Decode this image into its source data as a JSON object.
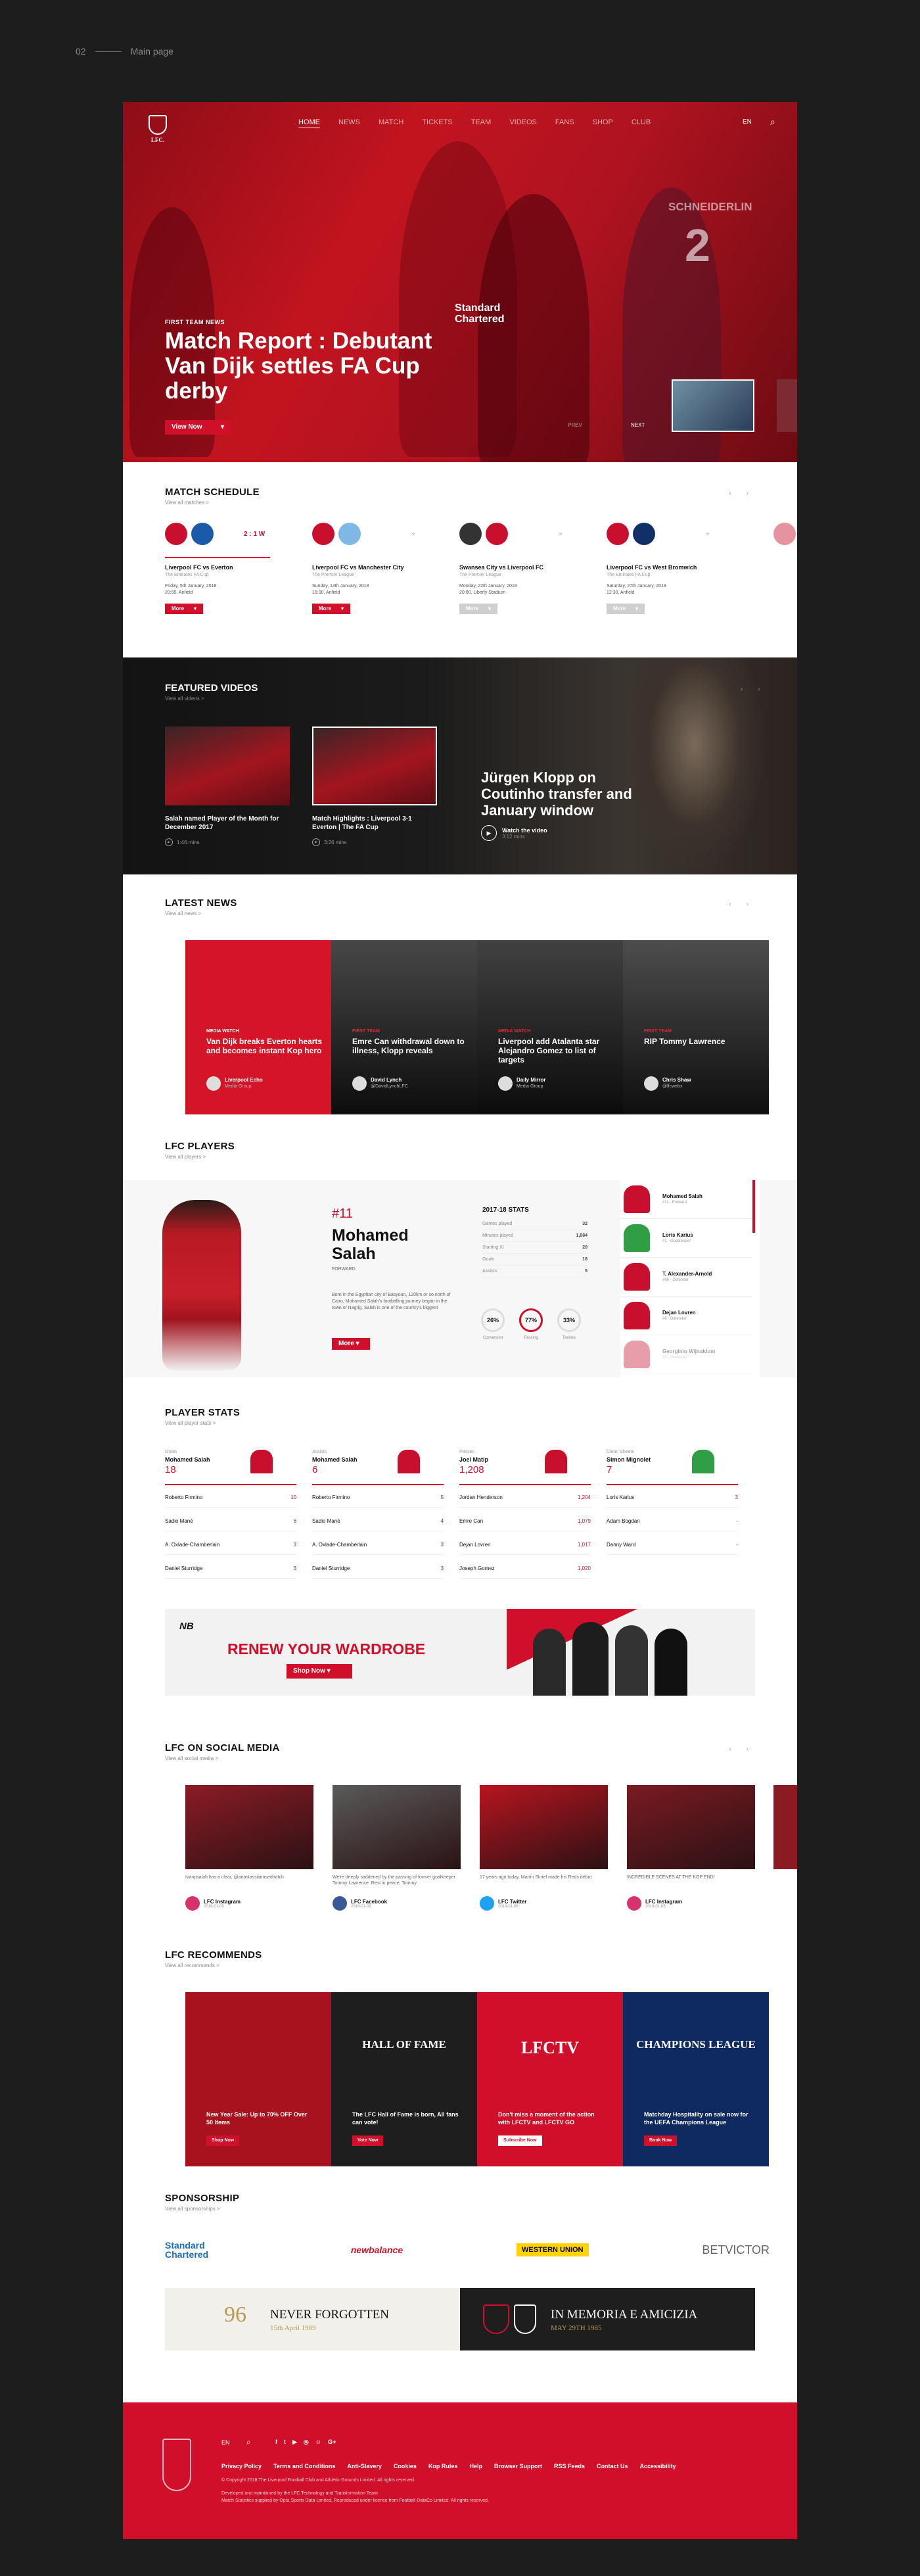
{
  "page_label": {
    "num": "02",
    "text": "Main page"
  },
  "nav": {
    "logo_text": "LFC.",
    "items": [
      "HOME",
      "NEWS",
      "MATCH",
      "TICKETS",
      "TEAM",
      "VIDEOS",
      "FANS",
      "SHOP",
      "CLUB"
    ],
    "lang": "EN"
  },
  "hero": {
    "kicker": "FIRST TEAM NEWS",
    "title": "Match Report : Debutant Van Dijk settles FA Cup derby",
    "button": "View Now",
    "sponsor": "Standard Chartered",
    "shirt_text": "SCHNEIDERLIN",
    "shirt_num": "2",
    "prev": "PREV",
    "next": "NEXT"
  },
  "schedule": {
    "title": "MATCH SCHEDULE",
    "sub": "View all matches >",
    "matches": [
      {
        "teams": "Liverpool FC vs Everton",
        "comp": "The Emirates FA Cup",
        "date": "Friday, 5th January, 2018",
        "venue": "20:55, Anfield",
        "score": "2 : 1 W",
        "btn": "More"
      },
      {
        "teams": "Liverpool FC vs Manchester City",
        "comp": "The Premier League",
        "date": "Sunday, 14th January, 2018",
        "venue": "16:00, Anfield",
        "score": "",
        "btn": "More"
      },
      {
        "teams": "Swansea City vs Liverpool FC",
        "comp": "The Premier League",
        "date": "Monday, 22th January, 2018",
        "venue": "20:00, Liberty Stadium",
        "score": "",
        "btn": "More"
      },
      {
        "teams": "Liverpool FC vs West Bromwich",
        "comp": "The Emirates FA Cup",
        "date": "Saturday, 27th January, 2018",
        "venue": "12:30, Anfield",
        "score": "",
        "btn": "More"
      }
    ]
  },
  "videos": {
    "title": "FEATURED VIDEOS",
    "sub": "View all videos >",
    "items": [
      {
        "title": "Salah named Player of the Month for December 2017",
        "dur": "1:46 mins"
      },
      {
        "title": "Match Highlights : Liverpool 3-1 Everton | The FA Cup",
        "dur": "3:26 mins"
      }
    ],
    "feature": {
      "title": "Jürgen Klopp on Coutinho transfer and January window",
      "cta": "Watch the video",
      "dur": "3:12 mins"
    }
  },
  "news": {
    "title": "LATEST NEWS",
    "sub": "View all news >",
    "items": [
      {
        "tag": "MEDIA WATCH",
        "title": "Van Dijk breaks Everton hearts and becomes instant Kop hero",
        "author": "Liverpool Echo",
        "handle": "Media Group"
      },
      {
        "tag": "FIRST TEAM",
        "title": "Emre Can withdrawal down to illness, Klopp reveals",
        "author": "David Lynch",
        "handle": "@DavidLynchLFC"
      },
      {
        "tag": "MEDIA WATCH",
        "title": "Liverpool add Atalanta star Alejandro Gomez to list of targets",
        "author": "Daily Mirror",
        "handle": "Media Group"
      },
      {
        "tag": "FIRST TEAM",
        "title": "RIP Tommy Lawrence",
        "author": "Chris Shaw",
        "handle": "@lfcwebx"
      }
    ]
  },
  "players": {
    "title": "LFC PLAYERS",
    "sub": "View all players >",
    "num": "#11",
    "first": "Mohamed",
    "last": "Salah",
    "pos": "FORWARD",
    "bio": "Born in the Egyptian city of Basyoun, 120km or so north of Cairo, Mohamed Salah's footballing journey began in the town of Nagrig. Salah is one of the country's biggest",
    "btn": "More",
    "stats_title": "2017-18 STATS",
    "stats": [
      [
        "Games played",
        "32"
      ],
      [
        "Minutes played",
        "1,884"
      ],
      [
        "Starting XI",
        "20"
      ],
      [
        "Goals",
        "18"
      ],
      [
        "Assists",
        "5"
      ]
    ],
    "rings": [
      [
        "26%",
        "Conversion"
      ],
      [
        "77%",
        "Passing"
      ],
      [
        "33%",
        "Tackles"
      ]
    ],
    "list": [
      [
        "Mohamed Salah",
        "#11 · Forward"
      ],
      [
        "Loris Karius",
        "#1 · Goalkeeper"
      ],
      [
        "T. Alexander-Arnold",
        "#66 · Defender"
      ],
      [
        "Dejan Lovren",
        "#6 · Defender"
      ],
      [
        "Georginio Wijnaldum",
        "#5 · Midfielder"
      ]
    ]
  },
  "pstats": {
    "title": "PLAYER STATS",
    "sub": "View all player stats >",
    "cols": [
      {
        "cat": "Goals",
        "leader": "Mohamed Salah",
        "val": "18",
        "rows": [
          [
            "Roberto Firmino",
            "10"
          ],
          [
            "Sadio Mané",
            "6"
          ],
          [
            "A. Oxlade-Chamberlain",
            "3"
          ],
          [
            "Daniel Sturridge",
            "3"
          ]
        ]
      },
      {
        "cat": "Assists",
        "leader": "Mohamed Salah",
        "val": "6",
        "rows": [
          [
            "Roberto Firmino",
            "5"
          ],
          [
            "Sadio Mané",
            "4"
          ],
          [
            "A. Oxlade-Chamberlain",
            "3"
          ],
          [
            "Daniel Sturridge",
            "3"
          ]
        ]
      },
      {
        "cat": "Passes",
        "leader": "Joel Matip",
        "val": "1,208",
        "rows": [
          [
            "Jordan Henderson",
            "1,204"
          ],
          [
            "Emre Can",
            "1,079"
          ],
          [
            "Dejan Lovren",
            "1,017"
          ],
          [
            "Joseph Gomez",
            "1,020"
          ]
        ]
      },
      {
        "cat": "Clean Sheets",
        "leader": "Simon Mignolet",
        "val": "7",
        "rows": [
          [
            "Loris Karius",
            "3"
          ],
          [
            "Adam Bogdan",
            "-"
          ],
          [
            "Danny Ward",
            "-"
          ],
          [
            "",
            ""
          ]
        ]
      }
    ]
  },
  "promo": {
    "title": "RENEW YOUR WARDROBE",
    "btn": "Shop Now"
  },
  "social": {
    "title": "LFC ON SOCIAL MEDIA",
    "sub": "View all social media >",
    "items": [
      {
        "text": "Ivanpsalah has a clear, @anastassilamsedhatch",
        "src": "LFC Instagram",
        "time": "2018-01-09"
      },
      {
        "text": "We're deeply saddened by the passing of former goalkeeper Tommy Lawrence. Rest in peace, Tommy.",
        "src": "LFC Facebook",
        "time": "2018-01-09"
      },
      {
        "text": "17 years ago today, Martin Skrtel made his Reds debut",
        "src": "LFC Twitter",
        "time": "2018-01-08"
      },
      {
        "text": "INCREDIBLE SCENES AT THE KOP END!",
        "src": "LFC Instagram",
        "time": "2018-01-06"
      }
    ]
  },
  "recommends": {
    "title": "LFC RECOMMENDS",
    "sub": "View all recommends >",
    "items": [
      {
        "head": "",
        "text": "New Year Sale: Up to 70% OFF Over 50 Items",
        "btn": "Shop Now"
      },
      {
        "head": "HALL OF FAME",
        "text": "The LFC Hall of Fame is born, All fans can vote!",
        "btn": "Vote Now"
      },
      {
        "head": "LFCTV",
        "text": "Don't miss a moment of the action with LFCTV and LFCTV GO",
        "btn": "Subscribe Now"
      },
      {
        "head": "CHAMPIONS LEAGUE",
        "text": "Matchday Hospitality on sale now for the UEFA Champions League",
        "btn": "Book Now"
      }
    ]
  },
  "sponsorship": {
    "title": "SPONSORSHIP",
    "sub": "View all sponsorships >",
    "logos": [
      "Standard Chartered",
      "newbalance",
      "WESTERN UNION",
      "BETVICTOR"
    ]
  },
  "memorial": {
    "left_year": "96",
    "left_title": "NEVER FORGOTTEN",
    "left_date": "15th April 1989",
    "right_title": "IN MEMORIA E AMICIZIA",
    "right_date": "MAY 29TH 1985"
  },
  "footer": {
    "lang": "EN",
    "links": [
      "Privacy Policy",
      "Terms and Conditions",
      "Anti-Slavery",
      "Cookies",
      "Kop Rules",
      "Help",
      "Browser Support",
      "RSS Feeds",
      "Contact Us",
      "Accessibility"
    ],
    "copy1": "© Copyright 2018 The Liverpool Football Club and Athletic Grounds Limited. All rights reserved.",
    "copy2": "Developed and maintained by the LFC Technology and Transformation Team",
    "copy3": "Match Statistics supplied by Opta Sports Data Limited. Reproduced under licence from Football DataCo Limited. All rights reserved."
  },
  "colors": {
    "accent": "#d0102a",
    "dark": "#151515"
  }
}
